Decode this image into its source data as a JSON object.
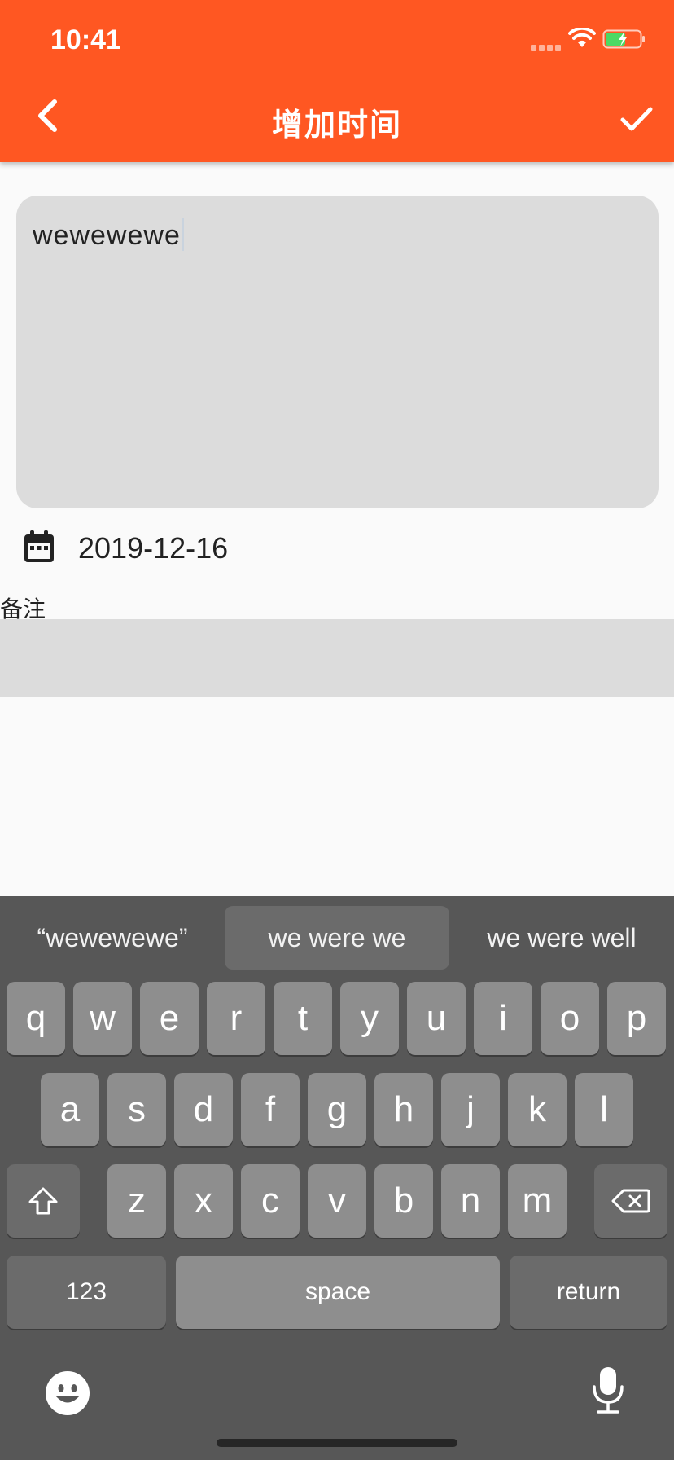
{
  "status_bar": {
    "time": "10:41"
  },
  "header": {
    "title": "增加时间"
  },
  "form": {
    "title_value": "wewewewe",
    "date": "2019-12-16",
    "remark_label": "备注",
    "remark_value": ""
  },
  "keyboard": {
    "suggestions": [
      "“wewewewe”",
      "we were we",
      "we were well"
    ],
    "rows": [
      [
        "q",
        "w",
        "e",
        "r",
        "t",
        "y",
        "u",
        "i",
        "o",
        "p"
      ],
      [
        "a",
        "s",
        "d",
        "f",
        "g",
        "h",
        "j",
        "k",
        "l"
      ],
      [
        "z",
        "x",
        "c",
        "v",
        "b",
        "n",
        "m"
      ]
    ],
    "numbers_key": "123",
    "space_key": "space",
    "return_key": "return"
  },
  "colors": {
    "accent": "#ff5722",
    "field_bg": "#dcdcdc",
    "keyboard_bg": "#575757"
  },
  "icons": [
    "back-arrow-icon",
    "check-icon",
    "calendar-icon",
    "shift-icon",
    "backspace-icon",
    "emoji-icon",
    "microphone-icon",
    "wifi-icon",
    "battery-icon"
  ]
}
